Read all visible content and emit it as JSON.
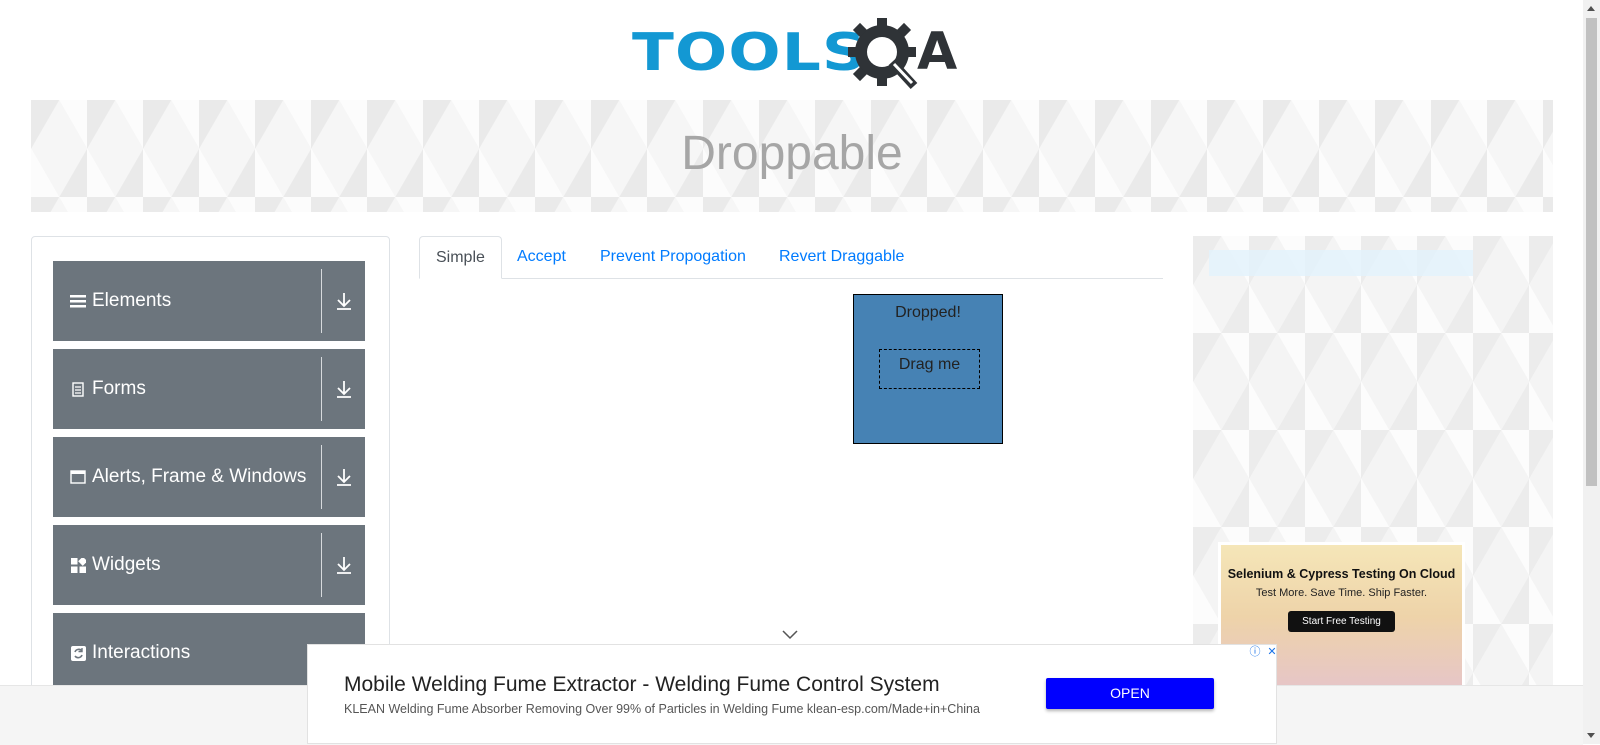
{
  "header": {
    "logo_text_tools": "TOOLS",
    "logo_text_a": "A"
  },
  "banner": {
    "title": "Droppable"
  },
  "sidebar": {
    "groups": [
      {
        "label": "Elements",
        "icon": "hamburger-icon"
      },
      {
        "label": "Forms",
        "icon": "document-icon"
      },
      {
        "label": "Alerts, Frame & Windows",
        "icon": "window-icon"
      },
      {
        "label": "Widgets",
        "icon": "grid-icon"
      },
      {
        "label": "Interactions",
        "icon": "refresh-icon"
      }
    ]
  },
  "tabs": [
    {
      "label": "Simple",
      "active": true
    },
    {
      "label": "Accept",
      "active": false
    },
    {
      "label": "Prevent Propogation",
      "active": false
    },
    {
      "label": "Revert Draggable",
      "active": false
    }
  ],
  "droppable": {
    "drop_text": "Dropped!",
    "drag_text": "Drag me",
    "drop_color": "#4682b4"
  },
  "right_ad": {
    "headline": "Selenium & Cypress Testing On Cloud",
    "subline": "Test More. Save Time. Ship Faster.",
    "button": "Start Free Testing"
  },
  "bottom_ad": {
    "title": "Mobile Welding Fume Extractor - Welding Fume Control System",
    "description": "KLEAN Welding Fume Absorber Removing Over 99% of Particles in Welding Fume klean-esp.com/Made+in+China",
    "button": "OPEN",
    "button_color": "#0000ff"
  },
  "colors": {
    "brand_blue": "#1398d3",
    "nav_gray": "#6c757d",
    "link_blue": "#007bff"
  }
}
